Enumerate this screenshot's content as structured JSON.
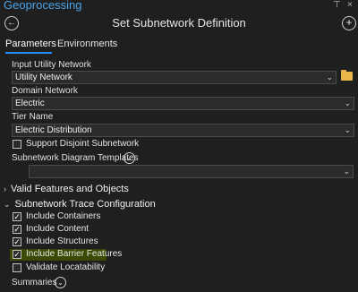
{
  "app": {
    "title": "Geoprocessing"
  },
  "window_controls": {
    "pin": "⊤",
    "close": "×"
  },
  "tool": {
    "title": "Set Subnetwork Definition"
  },
  "tabs": {
    "parameters": "Parameters",
    "environments": "Environments"
  },
  "params": {
    "input_utility_network": {
      "label": "Input Utility Network",
      "value": "Utility Network"
    },
    "domain_network": {
      "label": "Domain Network",
      "value": "Electric"
    },
    "tier_name": {
      "label": "Tier Name",
      "value": "Electric Distribution"
    },
    "support_disjoint": {
      "label": "Support Disjoint Subnetwork",
      "checked": false
    },
    "diagram_templates": {
      "label": "Subnetwork Diagram Templates",
      "value": ""
    }
  },
  "sections": {
    "valid_features": {
      "label": "Valid Features and Objects",
      "expanded": false
    },
    "trace_config": {
      "label": "Subnetwork Trace Configuration",
      "expanded": true
    }
  },
  "trace_options": [
    {
      "label": "Include Containers",
      "checked": true
    },
    {
      "label": "Include Content",
      "checked": true
    },
    {
      "label": "Include Structures",
      "checked": true
    },
    {
      "label": "Include Barrier Features",
      "checked": true,
      "highlighted": true
    },
    {
      "label": "Validate Locatability",
      "checked": false
    }
  ],
  "summaries": {
    "label": "Summaries"
  },
  "colors": {
    "accent": "#1e90ff",
    "app_title": "#4aa3e8",
    "highlight": "#3a4a00",
    "folder": "#e8b84a"
  }
}
